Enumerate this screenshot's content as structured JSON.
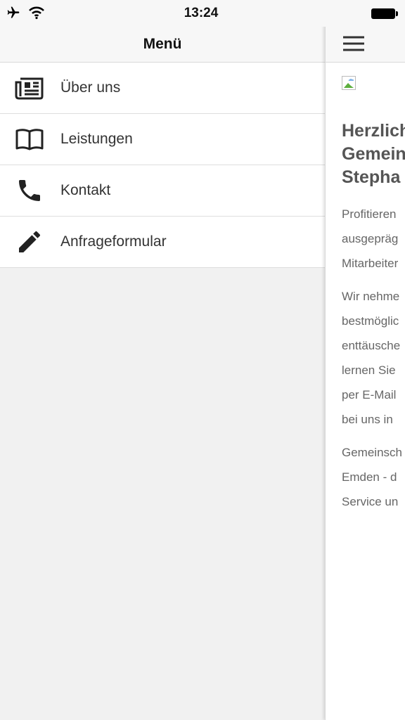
{
  "status_bar": {
    "time": "13:24",
    "icons": [
      "airplane-icon",
      "wifi-icon",
      "battery-icon"
    ]
  },
  "menu": {
    "title": "Menü",
    "items": [
      {
        "label": "Über uns",
        "icon": "newspaper-icon"
      },
      {
        "label": "Leistungen",
        "icon": "book-icon"
      },
      {
        "label": "Kontakt",
        "icon": "phone-icon"
      },
      {
        "label": "Anfrageformular",
        "icon": "pencil-icon"
      }
    ]
  },
  "content": {
    "heading_lines": [
      "Herzlich",
      "Gemein",
      "Stepha"
    ],
    "paragraphs": [
      [
        "Profitieren",
        "ausgepräg",
        "Mitarbeiter"
      ],
      [
        "Wir nehme",
        "bestmöglic",
        "enttäusche",
        "lernen Sie",
        "per E-Mail",
        "bei uns in"
      ],
      [
        "Gemeinsch",
        "Emden - d",
        "Service un"
      ]
    ]
  }
}
